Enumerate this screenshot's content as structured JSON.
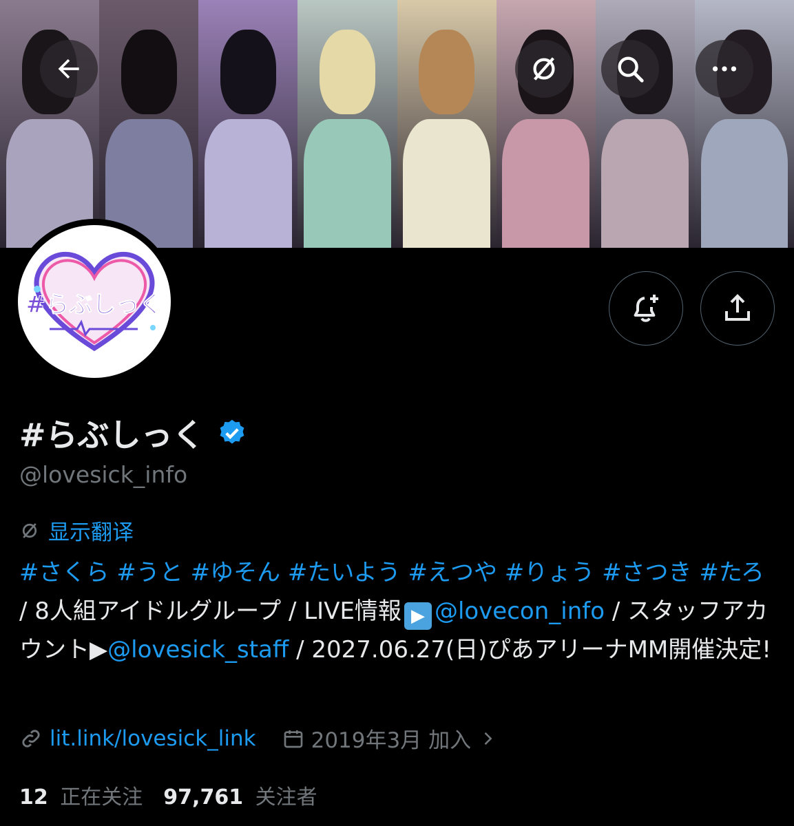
{
  "banner": {
    "panels": [
      {
        "bg": "#8a7b8e",
        "head": "#1a1518",
        "body": "#a9a3bd"
      },
      {
        "bg": "#6b5a6a",
        "head": "#120e12",
        "body": "#7e7ea0"
      },
      {
        "bg": "#9b82b8",
        "head": "#15111a",
        "body": "#b8b3d6"
      },
      {
        "bg": "#b9c7c2",
        "head": "#e6d9a8",
        "body": "#98c9b8"
      },
      {
        "bg": "#d8c9a8",
        "head": "#b58756",
        "body": "#e9e5cf"
      },
      {
        "bg": "#c6a7b0",
        "head": "#1a1418",
        "body": "#c998a8"
      },
      {
        "bg": "#aeaab8",
        "head": "#1c171c",
        "body": "#b9a6b0"
      },
      {
        "bg": "#b4b7c6",
        "head": "#221c22",
        "body": "#9ea7bb"
      }
    ]
  },
  "topbar": {
    "back_icon": "arrow-left-icon",
    "translate_icon": "translate-slash-icon",
    "search_icon": "search-icon",
    "more_icon": "more-horizontal-icon"
  },
  "actions": {
    "notify_icon": "bell-plus-icon",
    "share_icon": "share-upload-icon"
  },
  "profile": {
    "avatar_text": "#らぶしっく",
    "name": "#らぶしっく",
    "handle": "@lovesick_info",
    "translate_label": "显示翻译",
    "bio": {
      "hashtags": "#さくら #うと #ゆそん #たいよう #えつや #りょう #さつき #たろ",
      "sep1": " / 8人組アイドルグループ / LIVE情報",
      "play_icon": "▶",
      "mention1": "@lovecon_info",
      "sep2": " / スタッフアカウント▶",
      "mention2": "@lovesick_staff",
      "sep3": " / 2027.06.27(日)ぴあアリーナMM開催決定!"
    },
    "link": "lit.link/lovesick_link",
    "joined": "2019年3月 加入",
    "following_count": "12",
    "following_label": "正在关注",
    "followers_count": "97,761",
    "followers_label": "关注者"
  },
  "colors": {
    "accent": "#1d9bf0",
    "muted": "#71767b",
    "text": "#e7e9ea",
    "verified": "#1d9bf0"
  }
}
